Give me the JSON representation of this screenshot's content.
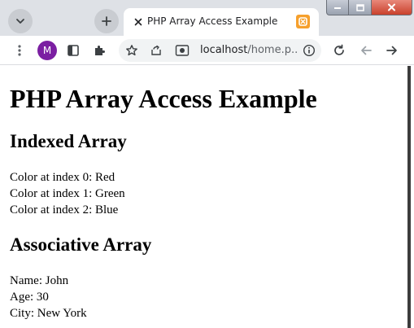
{
  "browser": {
    "tab": {
      "title": "PHP Array Access Example"
    },
    "profile_initial": "M",
    "address": {
      "host": "localhost",
      "path": "/home.p..."
    },
    "colors": {
      "tabstrip": "#dee1e6",
      "avatar": "#7b1fa2",
      "favicon": "#f6a02d"
    }
  },
  "page": {
    "heading": "PHP Array Access Example",
    "sections": [
      {
        "title": "Indexed Array",
        "lines": [
          "Color at index 0: Red",
          "Color at index 1: Green",
          "Color at index 2: Blue"
        ]
      },
      {
        "title": "Associative Array",
        "lines": [
          "Name: John",
          "Age: 30",
          "City: New York"
        ]
      }
    ]
  }
}
